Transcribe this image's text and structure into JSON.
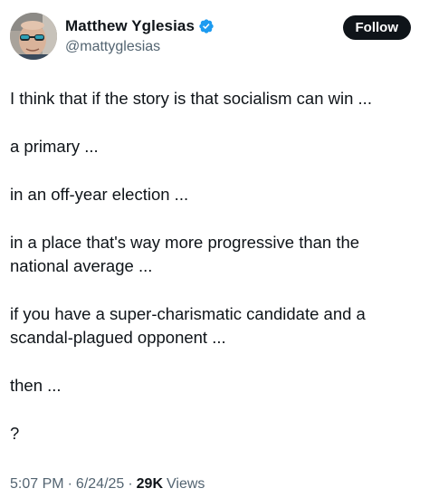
{
  "author": {
    "display_name": "Matthew Yglesias",
    "handle": "@mattyglesias",
    "verified_color": "#1d9bf0"
  },
  "follow_button": {
    "label": "Follow"
  },
  "tweet": {
    "paragraphs": [
      "I think that if the story is that socialism can win ...",
      "a primary ...",
      "in an off-year election ...",
      "in a place that's way more progressive than the national average ...",
      "if you have a super-charismatic candidate and a scandal-plagued opponent ...",
      "then ...",
      "?"
    ]
  },
  "meta": {
    "time": "5:07 PM",
    "date": "6/24/25",
    "views_count": "29K",
    "views_label": "Views",
    "separator": "·"
  },
  "icons": {
    "verified": "verified-badge-icon"
  }
}
